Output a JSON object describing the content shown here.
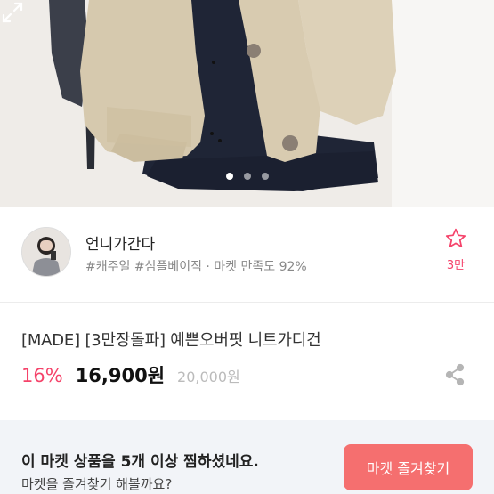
{
  "product_images": {
    "count": 3,
    "active_index": 0,
    "expand_icon": "expand-arrows-icon"
  },
  "shop": {
    "name": "언니가간다",
    "tags": "#캐주얼 #심플베이직 · 마켓 만족도 92%",
    "favorite_icon": "star-outline-icon",
    "favorite_count": "3만"
  },
  "product": {
    "title": "[MADE] [3만장돌파] 예쁜오버핏 니트가디건",
    "discount": "16%",
    "price": "16,900원",
    "original_price": "20,000원",
    "share_icon": "share-icon"
  },
  "banner": {
    "line1": "이 마켓 상품을 5개 이상 찜하셨네요.",
    "line2": "마켓을 즐겨찾기 해볼까요?",
    "button_label": "마켓 즐겨찾기",
    "button_color": "#f56f6f"
  },
  "colors": {
    "accent": "#f5436a",
    "banner_bg": "#f2f4f8"
  }
}
